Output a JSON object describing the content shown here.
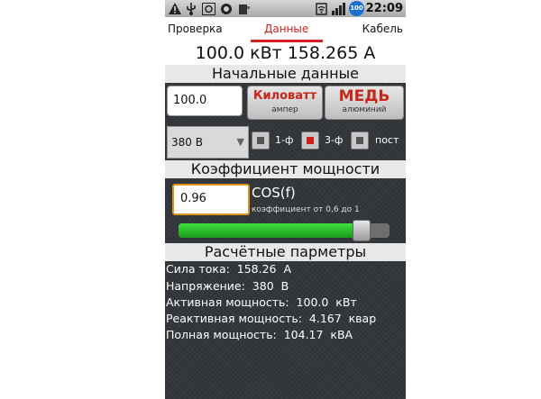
{
  "statusbar": {
    "battery": "100",
    "time": "22:09"
  },
  "tabs": [
    {
      "label": "Проверка"
    },
    {
      "label": "Данные"
    },
    {
      "label": "Кабель"
    }
  ],
  "reading": "100.0  кВт  158.265  А",
  "initial": {
    "title": "Начальные данные",
    "power_value": "100.0",
    "unit_button": {
      "main": "Киловатт",
      "sub": "ампер"
    },
    "material_button": {
      "main": "МЕДЬ",
      "sub": "алюминий"
    },
    "voltage": "380 В",
    "phase_options": [
      {
        "label": "1-ф",
        "checked": false
      },
      {
        "label": "3-ф",
        "checked": true
      },
      {
        "label": "пост",
        "checked": false
      }
    ]
  },
  "power_factor": {
    "title": "Коэффициент мощности",
    "value": "0.96",
    "label": "COS(f)",
    "hint": "коэффициент от 0,6 до 1",
    "slider_min": 0.6,
    "slider_max": 1.0,
    "slider_value": 0.96
  },
  "results": {
    "title": "Расчётные парметры",
    "lines": [
      "Сила тока:  158.26  А",
      "Напряжение:  380  В",
      "Активная мощность:  100.0  кВт",
      "Реактивная мощность:  4.167  квар",
      "Полная мощность:  104.17  кВА"
    ]
  },
  "colors": {
    "accent_red": "#d32020",
    "slider_green": "#2bc02b",
    "focus_orange": "#e0921f"
  }
}
